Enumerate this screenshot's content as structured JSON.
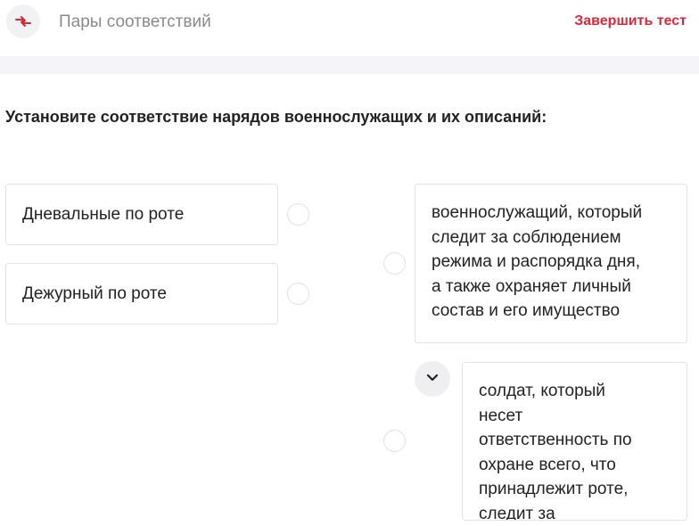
{
  "header": {
    "icon": "swap-arrows-icon",
    "title": "Пары соответствий",
    "finish_label": "Завершить тест"
  },
  "question": {
    "text": "Установите соответствие нарядов военнослужащих и их описаний:"
  },
  "left_items": [
    {
      "label": "Дневальные по роте"
    },
    {
      "label": "Дежурный по роте"
    }
  ],
  "right_items": [
    {
      "lines": [
        "военнослужащий, который",
        "следит за соблюдением",
        "режима и распорядка дня,",
        "а также охраняет личный",
        "состав и его имущество"
      ]
    },
    {
      "lines": [
        "солдат, который",
        "несет",
        "ответственность по",
        "охране всего, что",
        "принадлежит роте,",
        "следит за"
      ]
    }
  ],
  "colors": {
    "accent": "#d9283a",
    "muted_text": "#8a8a8e",
    "card_border": "#e3e3e6",
    "band": "#f4f5f9"
  }
}
